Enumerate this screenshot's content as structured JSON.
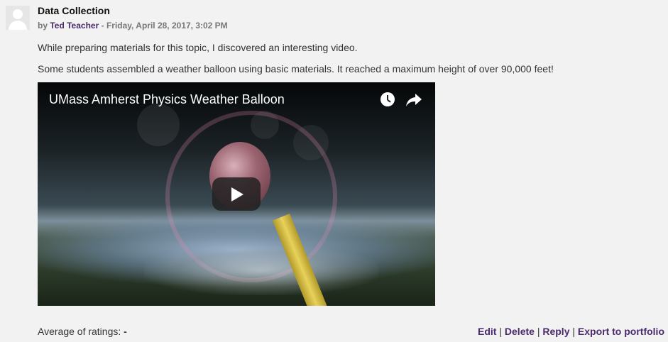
{
  "post": {
    "subject": "Data Collection",
    "author_prefix": "by ",
    "author": "Ted Teacher",
    "date_sep": " - ",
    "date": "Friday, April 28, 2017, 3:02 PM",
    "paragraph1": "While preparing materials for this topic, I discovered an interesting video.",
    "paragraph2": "Some students assembled a weather balloon using basic materials.  It reached a maximum height of over 90,000 feet!"
  },
  "video": {
    "title": "UMass Amherst Physics Weather Balloon",
    "icons": [
      "clock-icon",
      "share-icon",
      "play-icon"
    ]
  },
  "footer": {
    "rating_label": "Average of ratings: ",
    "rating_value": "-",
    "commands": [
      "Edit",
      "Delete",
      "Reply",
      "Export to portfolio"
    ],
    "separator": " | "
  },
  "colors": {
    "link": "#4b2a6b",
    "background": "#f2f2f2"
  }
}
